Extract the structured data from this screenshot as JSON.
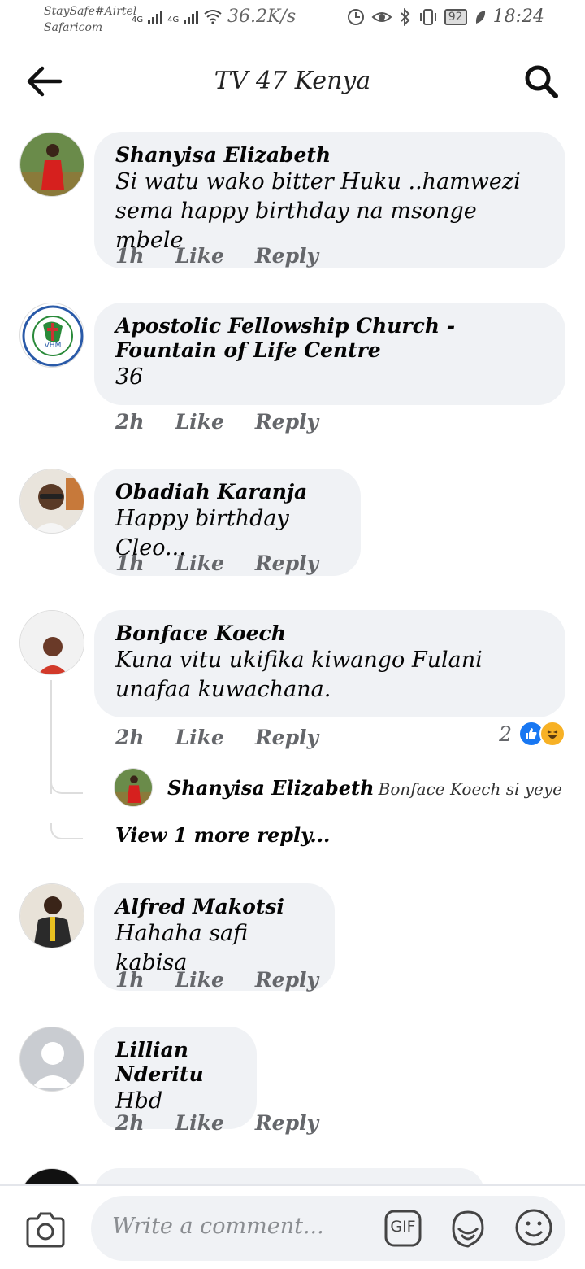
{
  "status_bar": {
    "carrier_line1": "StaySafe#Airtel",
    "carrier_line2": "Safaricom",
    "network1": "4G",
    "network2": "4G",
    "speed": "36.2K/s",
    "battery": "92",
    "time": "18:24"
  },
  "header": {
    "title": "TV 47 Kenya",
    "back_icon": "arrow-left-icon",
    "search_icon": "search-icon"
  },
  "comments": [
    {
      "author": "Shanyisa Elizabeth",
      "text": "Si watu wako bitter Huku ..hamwezi sema happy birthday na msonge mbele",
      "time": "1h",
      "like": "Like",
      "reply": "Reply"
    },
    {
      "author": "Apostolic Fellowship Church - Fountain of Life Centre",
      "text": "36",
      "time": "2h",
      "like": "Like",
      "reply": "Reply"
    },
    {
      "author": "Obadiah Karanja",
      "text": "Happy birthday Cleo...",
      "time": "1h",
      "like": "Like",
      "reply": "Reply"
    },
    {
      "author": "Bonface Koech",
      "text": "Kuna vitu ukifika kiwango Fulani unafaa kuwachana.",
      "time": "2h",
      "like": "Like",
      "reply": "Reply",
      "reaction_count": "2",
      "reactions": [
        "like-icon",
        "haha-icon"
      ],
      "replies": [
        {
          "author": "Shanyisa Elizabeth",
          "text": "Bonface Koech si yeye ni bi..."
        }
      ],
      "view_more": "View 1 more reply..."
    },
    {
      "author": "Alfred Makotsi",
      "text": "Hahaha safi kabisa",
      "time": "1h",
      "like": "Like",
      "reply": "Reply"
    },
    {
      "author": "Lillian Nderitu",
      "text": "Hbd",
      "time": "2h",
      "like": "Like",
      "reply": "Reply"
    }
  ],
  "composer": {
    "placeholder": "Write a comment...",
    "gif_label": "GIF"
  },
  "colors": {
    "bubble": "#f0f2f5",
    "meta_text": "#65676b",
    "like_blue": "#1877f2",
    "haha_yellow": "#f7b125"
  }
}
